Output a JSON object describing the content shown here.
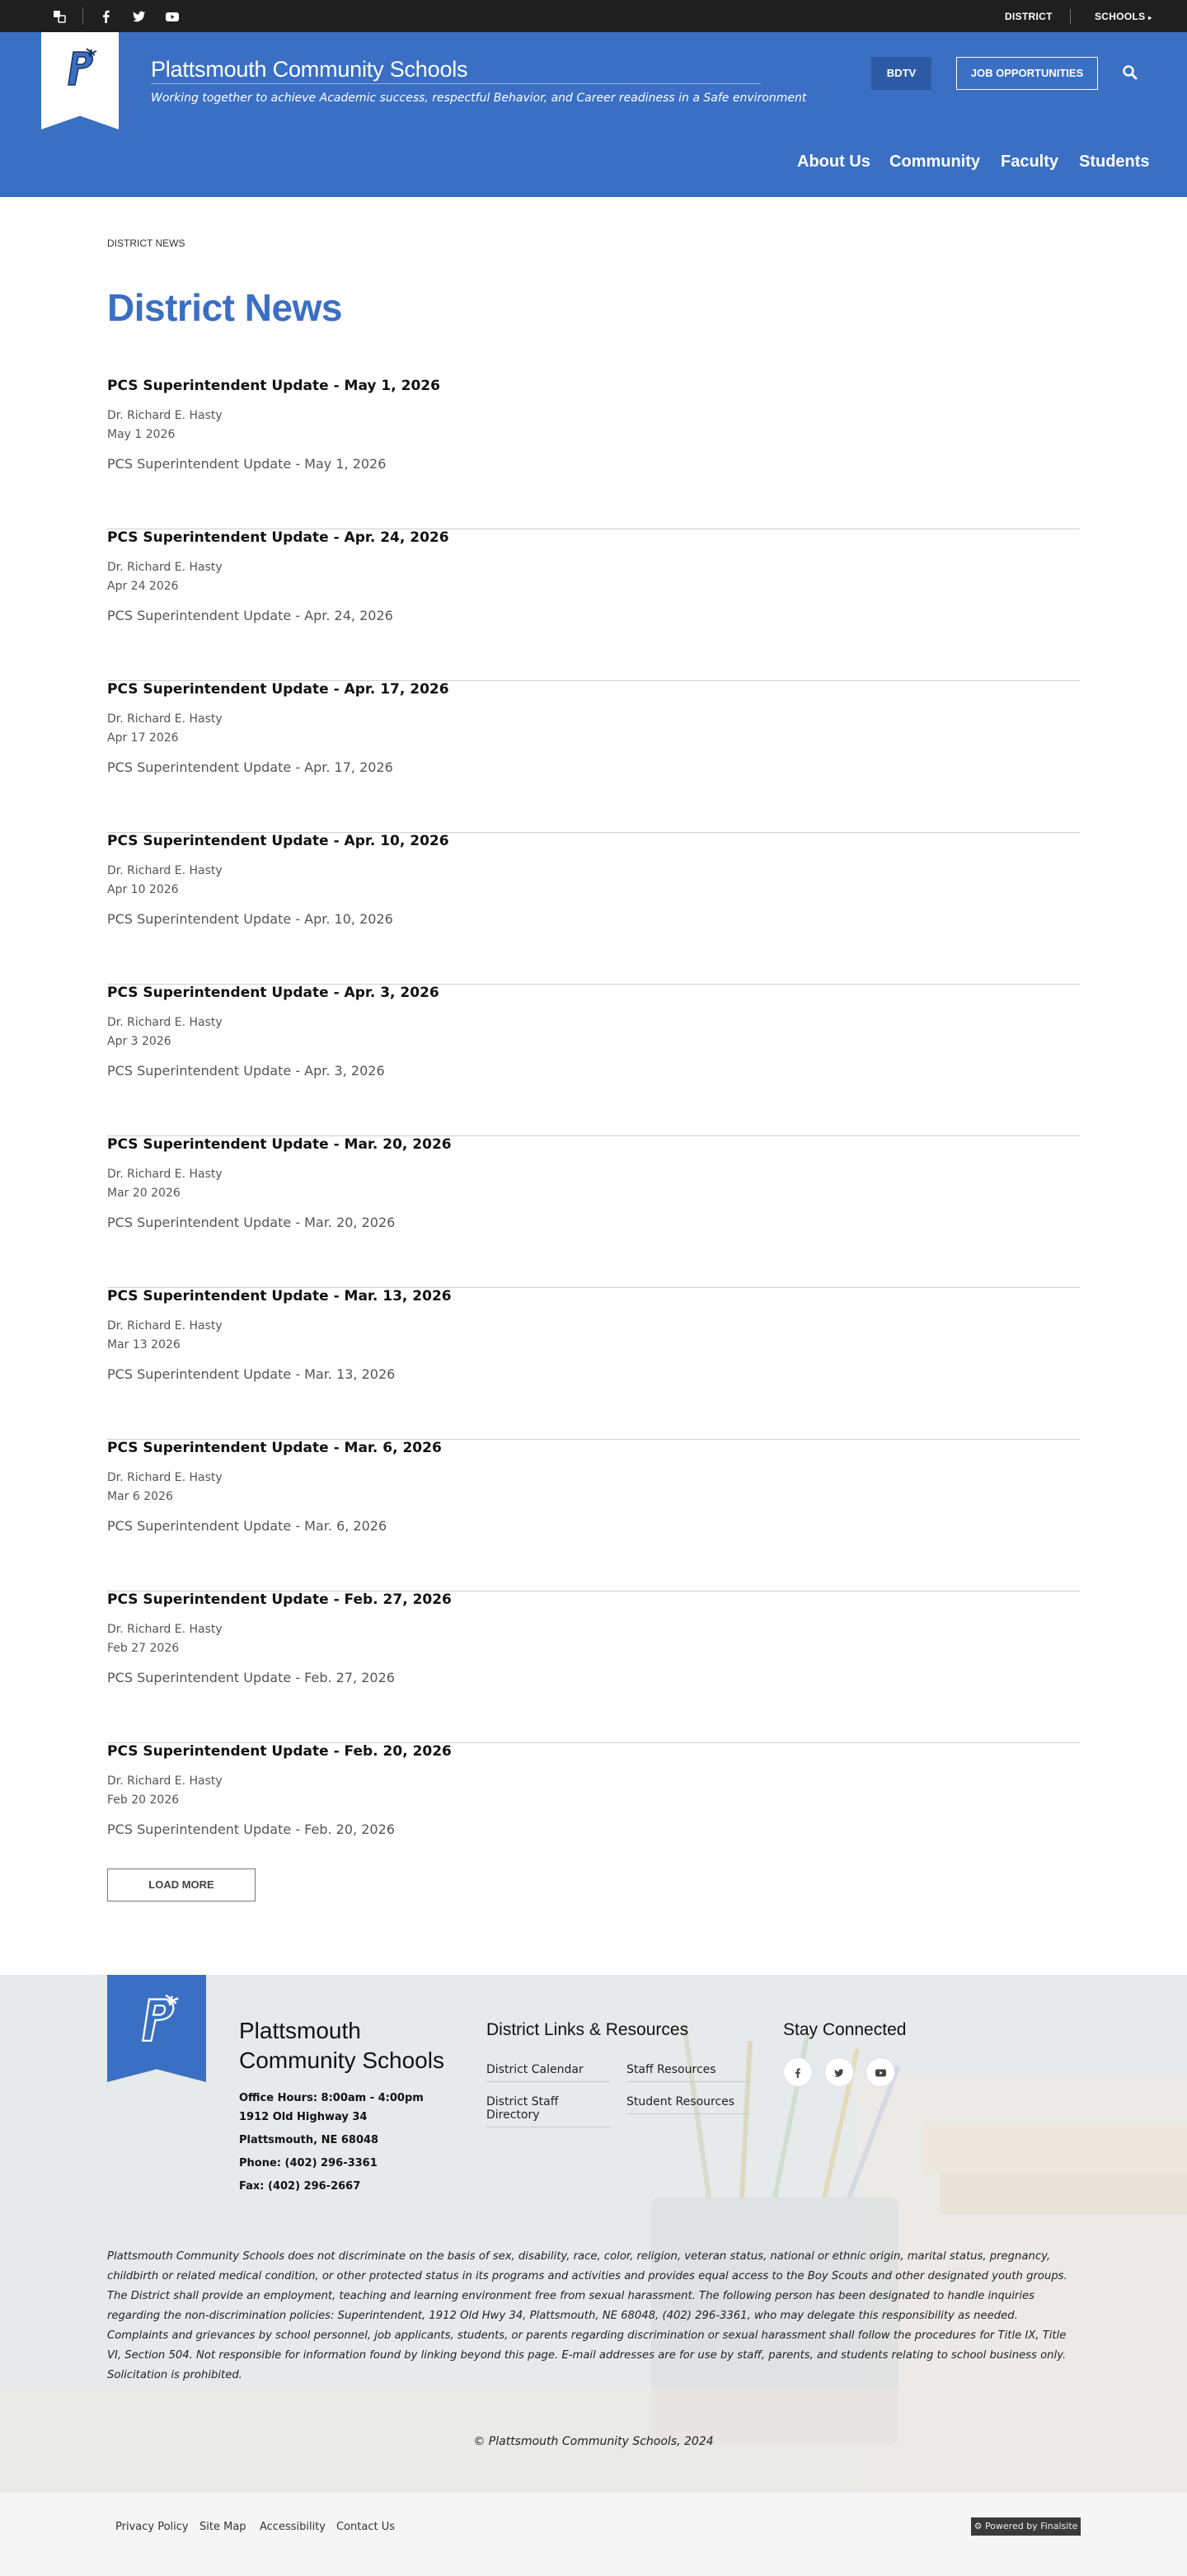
{
  "topbar": {
    "icons": [
      "translate-icon",
      "facebook-icon",
      "twitter-icon",
      "youtube-icon"
    ],
    "district_label": "DISTRICT",
    "schools_label": "SCHOOLS"
  },
  "header": {
    "site_title": "Plattsmouth Community Schools",
    "tagline": "Working together to achieve Academic success, respectful Behavior, and Career readiness in a Safe environment",
    "bdtv_label": "BDTV",
    "jobs_label": "JOB OPPORTUNITIES",
    "nav": [
      "About Us",
      "Community",
      "Faculty",
      "Students"
    ]
  },
  "breadcrumb": "DISTRICT NEWS",
  "page_title": "District News",
  "posts": [
    {
      "title": "PCS Superintendent Update - May 1, 2026",
      "author": "Dr. Richard E. Hasty",
      "date": "May 1 2026",
      "desc": "PCS Superintendent Update - May 1, 2026"
    },
    {
      "title": "PCS Superintendent Update - Apr. 24, 2026",
      "author": "Dr. Richard E. Hasty",
      "date": "Apr 24 2026",
      "desc": "PCS Superintendent Update - Apr. 24, 2026"
    },
    {
      "title": "PCS Superintendent Update - Apr. 17, 2026",
      "author": "Dr. Richard E. Hasty",
      "date": "Apr 17 2026",
      "desc": "PCS Superintendent Update - Apr. 17, 2026"
    },
    {
      "title": "PCS Superintendent Update - Apr. 10, 2026",
      "author": "Dr. Richard E. Hasty",
      "date": "Apr 10 2026",
      "desc": "PCS Superintendent Update - Apr. 10, 2026"
    },
    {
      "title": "PCS Superintendent Update - Apr. 3, 2026",
      "author": "Dr. Richard E. Hasty",
      "date": "Apr 3 2026",
      "desc": "PCS Superintendent Update - Apr. 3, 2026"
    },
    {
      "title": "PCS Superintendent Update - Mar. 20, 2026",
      "author": "Dr. Richard E. Hasty",
      "date": "Mar 20 2026",
      "desc": "PCS Superintendent Update - Mar. 20, 2026"
    },
    {
      "title": "PCS Superintendent Update - Mar. 13, 2026",
      "author": "Dr. Richard E. Hasty",
      "date": "Mar 13 2026",
      "desc": "PCS Superintendent Update - Mar. 13, 2026"
    },
    {
      "title": "PCS Superintendent Update - Mar. 6, 2026",
      "author": "Dr. Richard E. Hasty",
      "date": "Mar 6 2026",
      "desc": "PCS Superintendent Update - Mar. 6, 2026"
    },
    {
      "title": "PCS Superintendent Update - Feb. 27, 2026",
      "author": "Dr. Richard E. Hasty",
      "date": "Feb 27 2026",
      "desc": "PCS Superintendent Update - Feb. 27, 2026"
    },
    {
      "title": "PCS Superintendent Update - Feb. 20, 2026",
      "author": "Dr. Richard E. Hasty",
      "date": "Feb 20 2026",
      "desc": "PCS Superintendent Update - Feb. 20, 2026"
    }
  ],
  "load_more_label": "LOAD MORE",
  "footer": {
    "name": "Plattsmouth Community Schools",
    "office_hours": "Office Hours: 8:00am - 4:00pm",
    "address1": "1912 Old Highway 34",
    "address2": "Plattsmouth, NE  68048",
    "phone": "Phone: (402) 296-3361",
    "fax": "Fax: (402) 296-2667",
    "links_heading": "District Links & Resources",
    "links": [
      "District Calendar",
      "Staff Resources",
      "District Staff Directory",
      "Student Resources"
    ],
    "social_heading": "Stay Connected",
    "social_icons": [
      "facebook-icon",
      "twitter-icon",
      "youtube-icon"
    ],
    "legal": "Plattsmouth Community Schools does not discriminate on the basis of sex, disability, race, color, religion, veteran status, national or ethnic origin, marital status, pregnancy, childbirth or related medical condition, or other protected status in its programs and activities and provides equal access to the Boy Scouts and other designated youth groups. The District shall provide an employment, teaching and learning environment free from sexual harassment. The following person has been designated to handle inquiries regarding the non-discrimination policies: Superintendent, 1912 Old Hwy 34, Plattsmouth, NE 68048, (402) 296-3361, who may delegate this responsibility as needed. Complaints and grievances by school personnel, job applicants, students, or parents regarding discrimination or sexual harassment shall follow the procedures for Title IX, Title VI, Section 504. Not responsible for information found by linking beyond this page. E-mail addresses are for use by staff, parents, and students relating to school business only. Solicitation is prohibited.",
    "copyright": "© Plattsmouth Community Schools, 2024"
  },
  "bottom": {
    "links": [
      "Privacy Policy",
      "Site Map",
      "Accessibility",
      "Contact Us"
    ],
    "powered_by": "Powered by Finalsite"
  },
  "colors": {
    "brand_blue": "#3a6fc4",
    "topbar_bg": "#1f1f1f",
    "bdtv_bg": "#2d5aa5"
  }
}
